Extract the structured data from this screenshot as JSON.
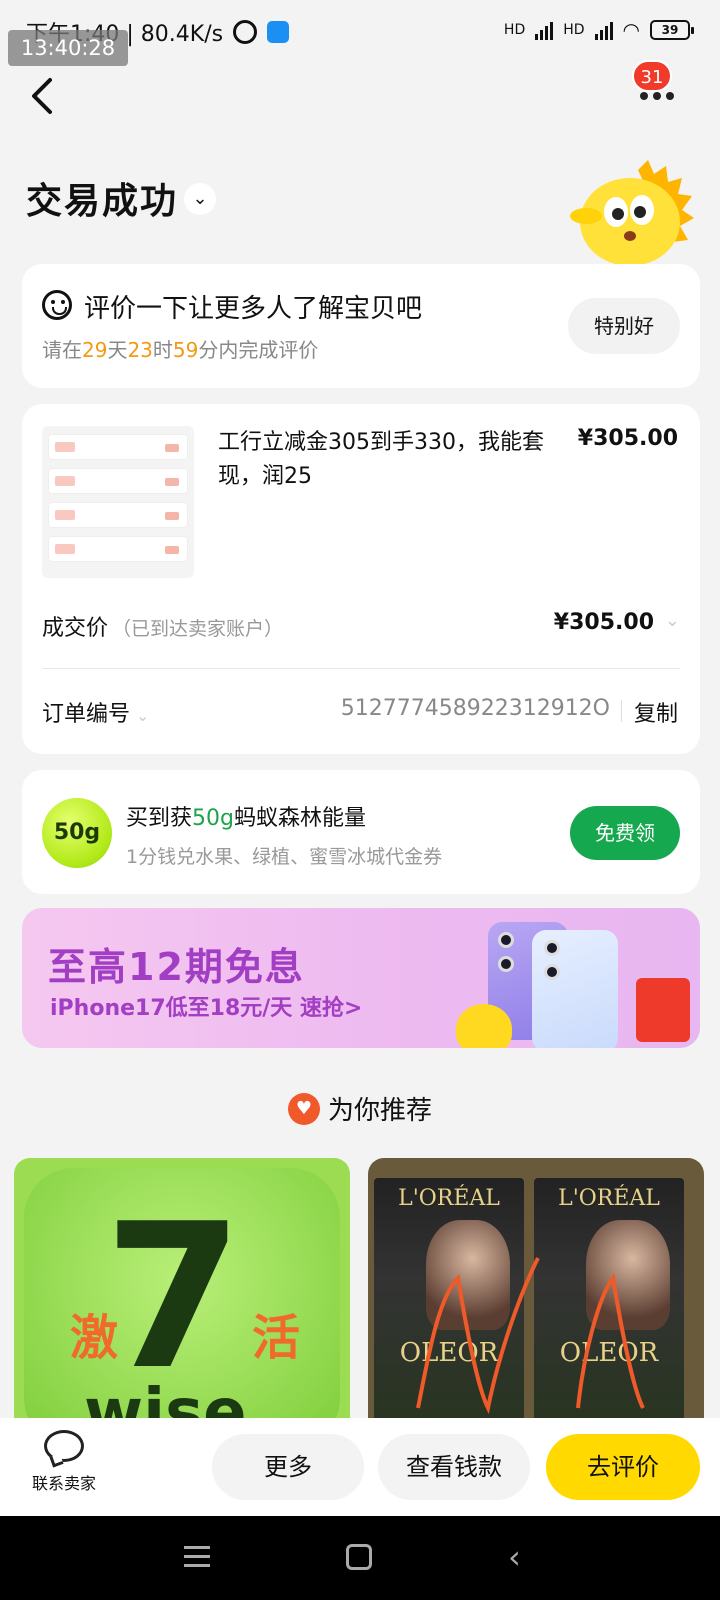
{
  "status_bar": {
    "time_text": "下午1:40 | 80.4K/s",
    "network_1": "HD",
    "network_2": "HD",
    "battery": "39"
  },
  "timestamp_overlay": "13:40:28",
  "header": {
    "message_badge": "31",
    "title": "交易成功"
  },
  "review_card": {
    "title": "评价一下让更多人了解宝贝吧",
    "sub_prefix": "请在",
    "days": "29",
    "days_unit": "天",
    "hours": "23",
    "hours_unit": "时",
    "minutes": "59",
    "sub_suffix": "分内完成评价",
    "button_label": "特别好"
  },
  "order": {
    "product_name": "工行立减金305到手330，我能套现，润25",
    "product_price": "¥305.00",
    "deal_label": "成交价",
    "deal_note": "（已到达卖家账户）",
    "deal_price": "¥305.00",
    "order_no_label": "订单编号",
    "order_no": "512777458922312912O",
    "copy_label": "复制"
  },
  "energy_card": {
    "badge": "50g",
    "title_prefix": "买到获",
    "title_highlight": "50g",
    "title_suffix": "蚂蚁森林能量",
    "subtitle": "1分钱兑水果、绿植、蜜雪冰城代金券",
    "button_label": "免费领"
  },
  "promo_banner": {
    "title": "至高12期免息",
    "subtitle": "iPhone17低至18元/天  速抢>"
  },
  "recommend": {
    "header": "为你推荐",
    "left_card": {
      "activate_1": "激",
      "activate_2": "活",
      "logo_glyph": "7",
      "logo_text": "wise"
    },
    "right_card": {
      "brand": "L'ORÉAL",
      "product": "OLEOR"
    }
  },
  "action_bar": {
    "contact_label": "联系卖家",
    "more_label": "更多",
    "view_money_label": "查看钱款",
    "review_label": "去评价"
  },
  "colors": {
    "accent_yellow": "#ffd900",
    "countdown_orange": "#f29a12",
    "green_button": "#15a84e",
    "promo_purple": "#a23ec4"
  }
}
